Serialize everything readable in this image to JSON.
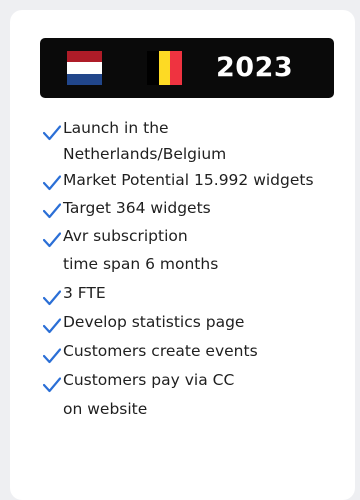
{
  "banner": {
    "year": "2023",
    "flags": [
      {
        "country": "Netherlands",
        "stripes": [
          "#ae1c28",
          "#ffffff",
          "#21468b"
        ],
        "orientation": "horizontal"
      },
      {
        "country": "Belgium",
        "stripes": [
          "#000000",
          "#fdda24",
          "#ef3340"
        ],
        "orientation": "vertical"
      }
    ]
  },
  "checklist": {
    "icon": "checkmark-icon",
    "check_color": "#2b6fd6",
    "items": [
      {
        "lines": [
          "Launch in the",
          "Netherlands/Belgium"
        ]
      },
      {
        "lines": [
          "Market Potential 15.992 widgets"
        ]
      },
      {
        "lines": [
          "Target 364 widgets"
        ]
      },
      {
        "lines": [
          "Avr subscription",
          "time span 6 months"
        ]
      },
      {
        "lines": [
          "3 FTE"
        ]
      },
      {
        "lines": [
          "Develop statistics page"
        ]
      },
      {
        "lines": [
          "Customers create events"
        ]
      },
      {
        "lines": [
          "Customers pay via CC",
          "on website"
        ]
      }
    ]
  }
}
